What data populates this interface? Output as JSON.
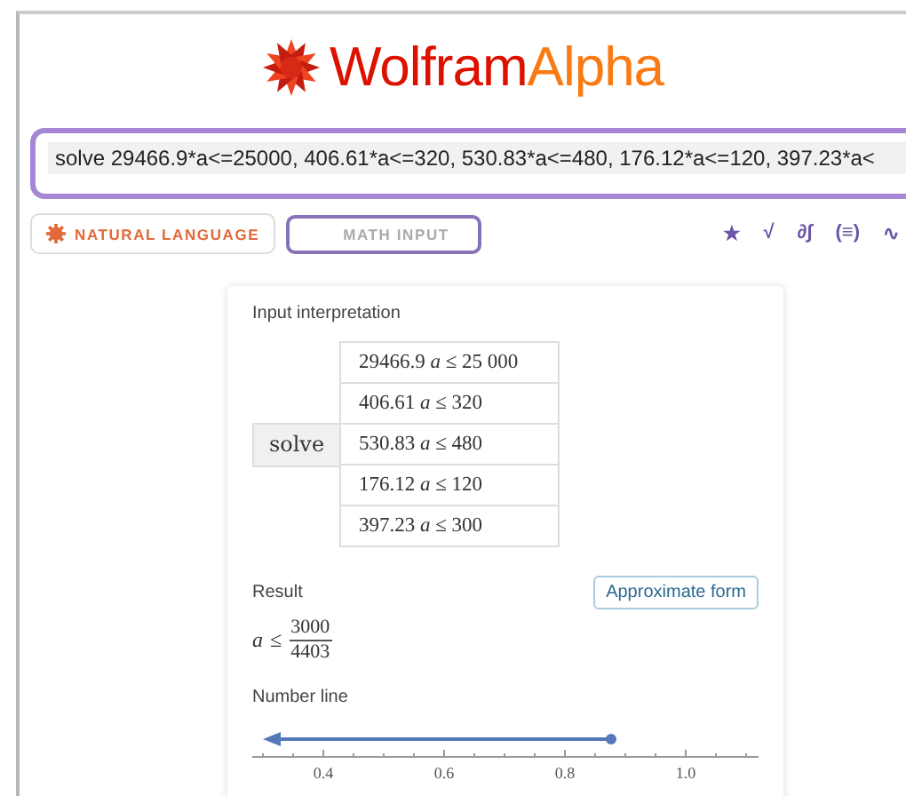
{
  "logo": {
    "part_1": "Wolfram",
    "part_2": "Alpha"
  },
  "search": {
    "value": "solve 29466.9*a<=25000, 406.61*a<=320, 530.83*a<=480, 176.12*a<=120, 397.23*a<"
  },
  "modes": [
    {
      "label": "NATURAL LANGUAGE",
      "selected": true
    },
    {
      "label": "MATH INPUT",
      "selected": false
    }
  ],
  "toolbar": [
    "★",
    "√",
    "∂∫",
    "(≡)",
    "∿"
  ],
  "input_interpretation": {
    "title": "Input interpretation",
    "command": "solve",
    "rows": [
      "29466.9 *a* ≤ 25 000",
      "406.61 *a* ≤ 320",
      "530.83 *a* ≤ 480",
      "176.12 *a* ≤ 120",
      "397.23 *a* ≤ 300"
    ]
  },
  "result": {
    "title": "Result",
    "button": "Approximate form",
    "variable": "a",
    "relation": "≤",
    "numerator": "3000",
    "denominator": "4403"
  },
  "number_line": {
    "title": "Number line",
    "ticks": [
      "0.4",
      "0.6",
      "0.8",
      "1.0"
    ]
  }
}
